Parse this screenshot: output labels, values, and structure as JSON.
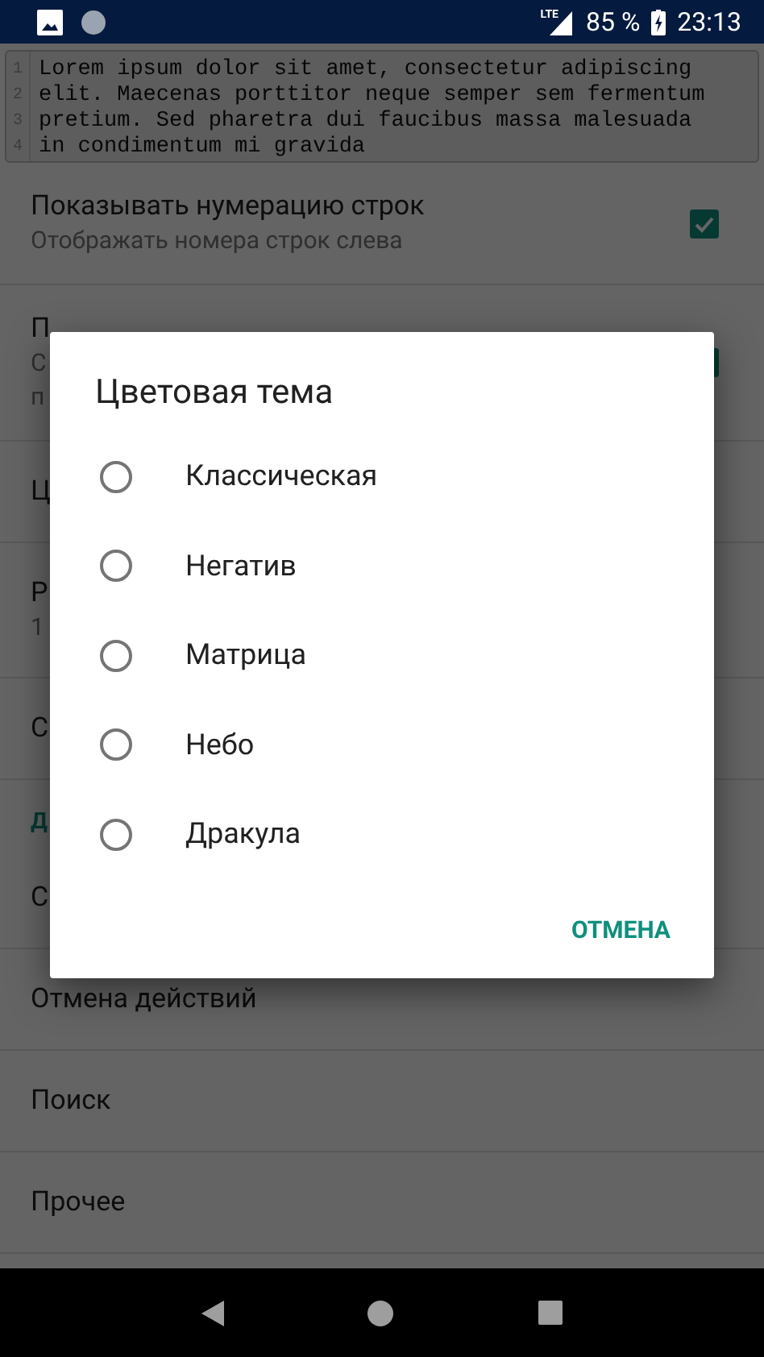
{
  "status_bar": {
    "network": "LTE",
    "battery": "85 %",
    "time": "23:13"
  },
  "editor": {
    "lines": [
      {
        "number": "1",
        "text": "Lorem ipsum dolor sit amet, consectetur adipiscing"
      },
      {
        "number": "2",
        "text": "elit. Maecenas porttitor neque semper sem fermentum"
      },
      {
        "number": "3",
        "text": "pretium. Sed pharetra dui faucibus massa malesuada"
      },
      {
        "number": "4",
        "text": "in condimentum mi gravida"
      }
    ]
  },
  "settings": [
    {
      "kind": "checkbox",
      "title": "Показывать нумерацию строк",
      "subtitle": [
        "Отображать номера строк слева"
      ],
      "checked": true
    },
    {
      "kind": "checkbox",
      "title": "П",
      "subtitle": [
        "С",
        "п"
      ],
      "checked": true
    },
    {
      "kind": "text",
      "title": "Ц"
    },
    {
      "kind": "text",
      "title": "Р",
      "subtitle": [
        "1"
      ]
    },
    {
      "kind": "text",
      "title": "С"
    },
    {
      "kind": "header",
      "title": "Д"
    },
    {
      "kind": "text",
      "title": "С"
    },
    {
      "kind": "text",
      "title": "Отмена действий"
    },
    {
      "kind": "text",
      "title": "Поиск"
    },
    {
      "kind": "text",
      "title": "Прочее"
    }
  ],
  "dialog": {
    "title": "Цветовая тема",
    "options": [
      {
        "label": "Классическая",
        "selected": false
      },
      {
        "label": "Негатив",
        "selected": false
      },
      {
        "label": "Матрица",
        "selected": false
      },
      {
        "label": "Небо",
        "selected": false
      },
      {
        "label": "Дракула",
        "selected": false
      }
    ],
    "cancel": "ОТМЕНА"
  }
}
